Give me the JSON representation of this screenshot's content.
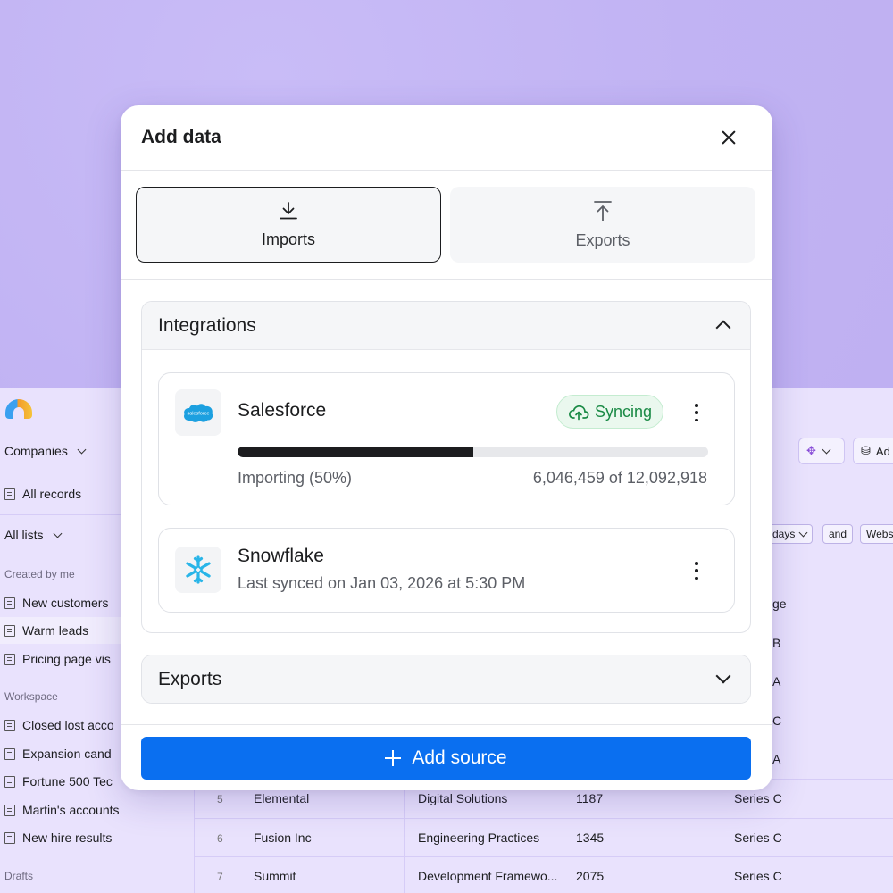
{
  "sidebar": {
    "workspace_selector": "Companies",
    "all_records": "All records",
    "all_lists": "All lists",
    "created_by_me_label": "Created by me",
    "created_items": [
      "New customers",
      "Warm leads",
      "Pricing page vis"
    ],
    "workspace_label": "Workspace",
    "workspace_items": [
      "Closed lost acco",
      "Expansion cand",
      "Fortune 500 Tec",
      "Martin's accounts",
      "New hire results"
    ],
    "drafts_label": "Drafts"
  },
  "table": {
    "toolbar_add_label": "Ad",
    "filter_chips": [
      "days",
      "and",
      "Webs"
    ],
    "stage_header": "ge",
    "stage_partials": [
      "B",
      "A",
      "C",
      "A"
    ],
    "rows": [
      {
        "num": "5",
        "name": "Elemental",
        "category": "Digital Solutions",
        "count": "1187",
        "stage": "Series C"
      },
      {
        "num": "6",
        "name": "Fusion Inc",
        "category": "Engineering Practices",
        "count": "1345",
        "stage": "Series C"
      },
      {
        "num": "7",
        "name": "Summit",
        "category": "Development Framewo...",
        "count": "2075",
        "stage": "Series C"
      }
    ]
  },
  "modal": {
    "title": "Add data",
    "tabs": {
      "imports": "Imports",
      "exports": "Exports"
    },
    "integrations": {
      "title": "Integrations",
      "salesforce": {
        "name": "Salesforce",
        "logo_text": "salesforce",
        "status": "Syncing",
        "progress_fraction": 0.5,
        "progress_label": "Importing (50%)",
        "count_label": "6,046,459 of 12,092,918"
      },
      "snowflake": {
        "name": "Snowflake",
        "subtitle": "Last synced on Jan 03, 2026 at 5:30 PM"
      }
    },
    "exports_section": {
      "title": "Exports"
    },
    "add_source_label": "Add source"
  },
  "colors": {
    "accent": "#0a6ff0",
    "sync_green": "#1a8a45",
    "background": "#c5b8f5"
  }
}
